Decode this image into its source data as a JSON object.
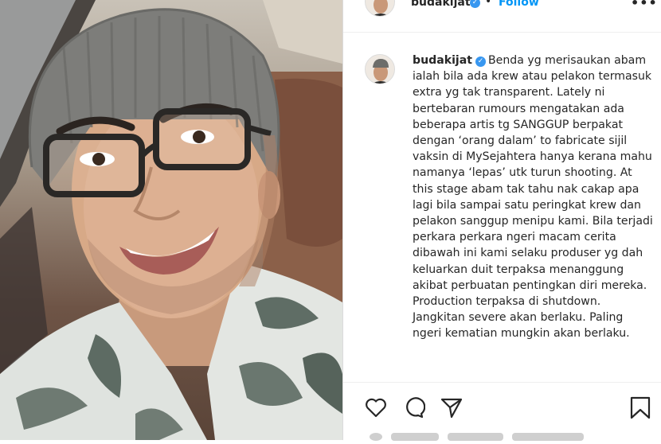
{
  "post": {
    "username": "budakijat",
    "verified_mark": "✓",
    "separator": "•",
    "follow_label": "Follow",
    "more_label": "•••",
    "caption": "Benda yg merisaukan abam ialah bila ada krew atau pelakon termasuk extra yg tak transparent. Lately ni bertebaran rumours mengatakan ada beberapa artis tg SANGGUP berpakat dengan ‘orang dalam’ to fabricate sijil vaksin di MySejahtera hanya kerana mahu namanya ‘lepas’ utk turun shooting. At this stage abam tak tahu nak cakap apa lagi bila sampai satu peringkat krew dan pelakon sanggup menipu kami. Bila terjadi perkara perkara ngeri macam cerita dibawah ini kami selaku produser yg dah keluarkan duit terpaksa menanggung akibat perbuatan pentingkan diri mereka. Production terpaksa di shutdown. Jangkitan severe akan berlaku. Paling ngeri kematian mungkin akan berlaku."
  },
  "icons": {
    "like": "heart-outline",
    "comment": "speech-bubble-outline",
    "share": "paper-plane-outline",
    "save": "bookmark-outline",
    "verified": "verified-badge"
  },
  "colors": {
    "link_blue": "#0095f6",
    "verified_blue": "#3897f0",
    "text": "#262626",
    "border": "#dbdbdb"
  }
}
